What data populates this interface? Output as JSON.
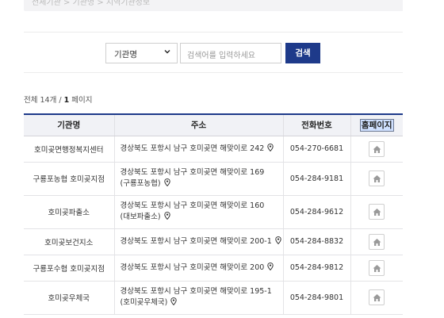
{
  "breadcrumb": {
    "text": "전체기관 > 기관명 > 지역기관정보"
  },
  "search": {
    "select_value": "기관명",
    "placeholder": "검색어를 입력하세요",
    "button_label": "검색"
  },
  "summary": {
    "prefix": "전체 14개 / ",
    "page_num": "1",
    "suffix": " 페이지"
  },
  "table": {
    "headers": [
      "기관명",
      "주소",
      "전화번호",
      "홈페이지"
    ],
    "rows": [
      {
        "name": "호미곶면행정복지센터",
        "addr1": "경상북도 포항시 남구 호미곶면 해맞이로 242",
        "addr2": "",
        "tel": "054-270-6681"
      },
      {
        "name": "구룡포농협 호미곶지점",
        "addr1": "경상북도 포항시 남구 호미곶면 해맞이로 169",
        "addr2": "(구룡포농협)",
        "tel": "054-284-9181"
      },
      {
        "name": "호미곶파출소",
        "addr1": "경상북도 포항시 남구 호미곶면 해맞이로 160",
        "addr2": "(대보파출소)",
        "tel": "054-284-9612"
      },
      {
        "name": "호미곶보건지소",
        "addr1": "경상북도 포항시 남구 호미곶면 해맞이로 200-1",
        "addr2": "",
        "tel": "054-284-8832"
      },
      {
        "name": "구룡포수협 호미곶지점",
        "addr1": "경상북도 포항시 남구 호미곶면 해맞이로 200",
        "addr2": "",
        "tel": "054-284-9812"
      },
      {
        "name": "호미곶우체국",
        "addr1": "경상북도 포항시 남구 호미곶면 해맞이로 195-1",
        "addr2": "(호미곶우체국)",
        "tel": "054-284-9801"
      }
    ]
  },
  "colors": {
    "accent": "#1e3a8a",
    "header_bg": "#f1f2f6",
    "pin": "#333333"
  },
  "icons": {
    "map_pin": "map-pin-icon",
    "home": "home-icon",
    "chevron": "chevron-down-icon"
  }
}
